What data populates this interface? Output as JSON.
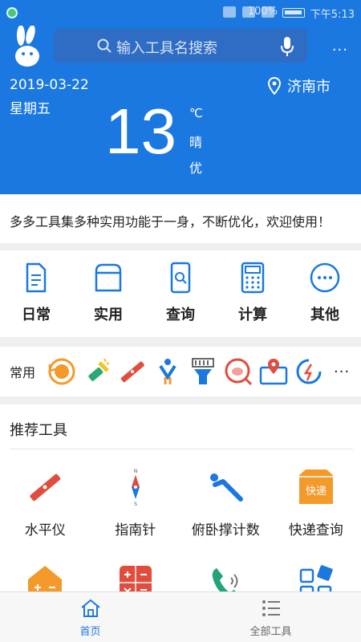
{
  "status_bar": {
    "battery": "100%",
    "time": "下午5:13"
  },
  "header": {
    "search_placeholder": "输入工具名搜索",
    "more": "···",
    "date": "2019-03-22",
    "weekday": "星期五",
    "city": "济南市",
    "temperature": "13",
    "unit": "℃",
    "condition": "晴",
    "air_quality": "优"
  },
  "notice": "多多工具集多种实用功能于一身，不断优化，欢迎使用！",
  "categories": [
    {
      "label": "日常",
      "icon": "document-icon"
    },
    {
      "label": "实用",
      "icon": "box-icon"
    },
    {
      "label": "查询",
      "icon": "phone-search-icon"
    },
    {
      "label": "计算",
      "icon": "calculator-icon"
    },
    {
      "label": "其他",
      "icon": "more-circle-icon"
    }
  ],
  "frequent": {
    "label": "常用",
    "more": "···",
    "icons": [
      "history-icon",
      "flashlight-icon",
      "level-icon",
      "pushup-icon",
      "barcode-scanner-icon",
      "pig-search-icon",
      "map-location-icon",
      "speed-test-icon"
    ]
  },
  "recommend": {
    "title": "推荐工具",
    "items": [
      {
        "label": "水平仪",
        "icon": "level-icon"
      },
      {
        "label": "指南针",
        "icon": "compass-icon"
      },
      {
        "label": "俯卧撑计数",
        "icon": "pushup-icon"
      },
      {
        "label": "快递查询",
        "icon": "express-box-icon"
      },
      {
        "label": "",
        "icon": "house-calculator-icon"
      },
      {
        "label": "",
        "icon": "calculator-icon"
      },
      {
        "label": "",
        "icon": "phone-call-icon"
      },
      {
        "label": "",
        "icon": "apps-grid-icon"
      }
    ],
    "express_box_text": "快递"
  },
  "bottom_nav": {
    "home": "首页",
    "all_tools": "全部工具"
  },
  "colors": {
    "brand_blue": "#1a78e0",
    "search_bg": "#2f6cc4",
    "orange": "#f39a2b",
    "red": "#e24c3c"
  }
}
